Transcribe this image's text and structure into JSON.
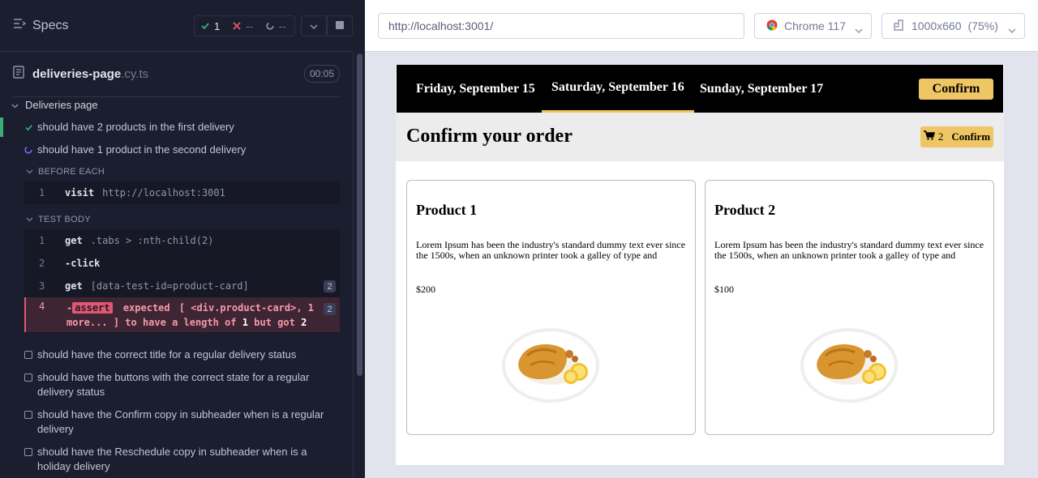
{
  "reporter": {
    "title": "Specs",
    "stats": {
      "passed": "1",
      "failed": "--",
      "pending": "--"
    },
    "spec_file": {
      "name": "deliveries-page",
      "ext": ".cy.ts",
      "duration": "00:05"
    },
    "suite": "Deliveries page",
    "tests": [
      {
        "label": "should have 2 products in the first delivery",
        "state": "passed"
      },
      {
        "label": "should have 1 product in the second delivery",
        "state": "running"
      }
    ],
    "before_each": {
      "label": "BEFORE EACH",
      "commands": [
        {
          "num": "1",
          "name": "visit",
          "arg": "http://localhost:3001"
        }
      ]
    },
    "test_body": {
      "label": "TEST BODY",
      "commands": [
        {
          "num": "1",
          "name": "get",
          "arg": ".tabs > :nth-child(2)",
          "badge": ""
        },
        {
          "num": "2",
          "name": "-click",
          "arg": "",
          "badge": ""
        },
        {
          "num": "3",
          "name": "get",
          "arg": "[data-test-id=product-card]",
          "badge": "2"
        }
      ],
      "failed_command": {
        "num": "4",
        "prefix": "-",
        "name": "assert",
        "text_1": "expected",
        "text_2": "[ <div.product-card>, 1",
        "text_3": "more... ]",
        "text_4": "to have a length of",
        "expected": "1",
        "text_5": "but got",
        "actual": "2",
        "badge": "2"
      }
    },
    "pending_tests": [
      {
        "line1": "should have the correct title for a regular delivery status",
        "line2": ""
      },
      {
        "line1": "should have the buttons with the correct state for a regular",
        "line2": "delivery status"
      },
      {
        "line1": "should have the Confirm copy in subheader when is a regular",
        "line2": "delivery"
      },
      {
        "line1": "should have the Reschedule copy in subheader when is a",
        "line2": "holiday delivery"
      }
    ]
  },
  "browser": {
    "url": "http://localhost:3001/",
    "browser_name": "Chrome 117",
    "viewport": "1000x660",
    "zoom": "(75%)"
  },
  "app": {
    "days": [
      {
        "label": "Friday, September 15",
        "active": false
      },
      {
        "label": "Saturday, September 16",
        "active": true
      },
      {
        "label": "Sunday, September 17",
        "active": false
      }
    ],
    "confirm_button": "Confirm",
    "page_title": "Confirm your order",
    "cart_count": "2",
    "cart_button": "Confirm",
    "products": [
      {
        "title": "Product 1",
        "desc": "Lorem Ipsum has been the industry's standard dummy text ever since the 1500s, when an unknown printer took a galley of type and scrambled it to make a type specimen book.",
        "price": "$200"
      },
      {
        "title": "Product 2",
        "desc": "Lorem Ipsum has been the industry's standard dummy text ever since the 1500s, when an unknown printer took a galley of type and scrambled it to make a type specimen book.",
        "price": "$100"
      }
    ]
  },
  "colors": {
    "accent": "#efc664",
    "pass": "#3dae7b",
    "fail": "#e45770",
    "running": "#6470f3"
  },
  "icons": [
    "list-icon",
    "check-icon",
    "x-icon",
    "spinner-icon",
    "chevron-down-icon",
    "stop-icon",
    "file-icon",
    "chrome-icon",
    "viewport-icon",
    "cart-icon"
  ]
}
